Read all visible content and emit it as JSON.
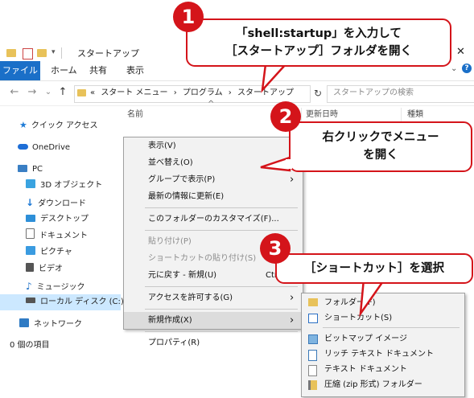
{
  "window": {
    "title": "スタートアップ",
    "controls": {
      "minimize": "—",
      "maximize": "☐",
      "close": "✕"
    }
  },
  "ribbon": {
    "tabs": [
      "ファイル",
      "ホーム",
      "共有",
      "表示"
    ],
    "collapse_icon": "chevron-down"
  },
  "address": {
    "back": "←",
    "forward": "→",
    "dropdown": "⌄",
    "up": "↑",
    "path_prefix": "«",
    "crumbs": [
      "スタート メニュー",
      "プログラム",
      "スタートアップ"
    ],
    "separator": "›",
    "refresh": "↻",
    "search_placeholder": "スタートアップの検索",
    "search_icon": "magnifier"
  },
  "sidebar": {
    "items": [
      {
        "label": "クイック アクセス",
        "icon": "star",
        "color": "#1e7bd6"
      },
      {
        "label": "OneDrive",
        "icon": "cloud",
        "color": "#1e6ed6"
      },
      {
        "label": "PC",
        "icon": "computer",
        "color": "#3a7fc4"
      },
      {
        "label": "3D オブジェクト",
        "icon": "cube",
        "color": "#3aa3e0"
      },
      {
        "label": "ダウンロード",
        "icon": "download-arrow",
        "color": "#1c78d4"
      },
      {
        "label": "デスクトップ",
        "icon": "desktop",
        "color": "#2d8fd8"
      },
      {
        "label": "ドキュメント",
        "icon": "document",
        "color": "#707070"
      },
      {
        "label": "ピクチャ",
        "icon": "picture",
        "color": "#3a9be0"
      },
      {
        "label": "ビデオ",
        "icon": "film",
        "color": "#555555"
      },
      {
        "label": "ミュージック",
        "icon": "music-note",
        "color": "#1f72c8"
      },
      {
        "label": "ローカル ディスク (C:)",
        "icon": "drive",
        "color": "#555555"
      },
      {
        "label": "ネットワーク",
        "icon": "network",
        "color": "#2f7bc4"
      }
    ]
  },
  "columns": {
    "name": "名前",
    "modified": "更新日時",
    "type": "種類",
    "sort_arrow": "^"
  },
  "status": {
    "items": "0 個の項目"
  },
  "context_menu": {
    "items": [
      {
        "label": "表示(V)",
        "disabled": false,
        "arrow": true
      },
      {
        "label": "並べ替え(O)",
        "disabled": false,
        "arrow": true
      },
      {
        "label": "グループで表示(P)",
        "disabled": false,
        "arrow": true
      },
      {
        "label": "最新の情報に更新(E)",
        "disabled": false,
        "arrow": false
      },
      {
        "sep": true
      },
      {
        "label": "このフォルダーのカスタマイズ(F)...",
        "disabled": false,
        "arrow": false
      },
      {
        "sep": true
      },
      {
        "label": "貼り付け(P)",
        "disabled": true,
        "arrow": false
      },
      {
        "label": "ショートカットの貼り付け(S)",
        "disabled": true,
        "arrow": false
      },
      {
        "label": "元に戻す - 新規(U)",
        "disabled": false,
        "arrow": false,
        "shortcut": "Ctrl+Z"
      },
      {
        "sep": true
      },
      {
        "label": "アクセスを許可する(G)",
        "disabled": false,
        "arrow": true
      },
      {
        "sep": true
      },
      {
        "label": "新規作成(X)",
        "disabled": false,
        "arrow": true,
        "highlighted": true
      },
      {
        "sep": true
      },
      {
        "label": "プロパティ(R)",
        "disabled": false,
        "arrow": false
      }
    ],
    "submenu_arrow": "›"
  },
  "submenu": {
    "items": [
      {
        "label": "フォルダー(F)",
        "icon": "folder"
      },
      {
        "label": "ショートカット(S)",
        "icon": "shortcut"
      },
      {
        "sep": true
      },
      {
        "label": "ビットマップ イメージ",
        "icon": "bitmap"
      },
      {
        "label": "リッチ テキスト ドキュメント",
        "icon": "rtf"
      },
      {
        "label": "テキスト ドキュメント",
        "icon": "text"
      },
      {
        "label": "圧縮 (zip 形式) フォルダー",
        "icon": "zip"
      }
    ]
  },
  "annotations": [
    {
      "number": "1",
      "line1": "「shell:startup」を入力して",
      "line2": "［スタートアップ］フォルダを開く"
    },
    {
      "number": "2",
      "line1": "右クリックでメニュー",
      "line2": "を開く"
    },
    {
      "number": "3",
      "line1": "［ショートカット］を選択",
      "line2": ""
    }
  ],
  "colors": {
    "accent_red": "#d4141a",
    "file_tab_blue": "#1a6fc8",
    "selection": "#cce8ff"
  }
}
